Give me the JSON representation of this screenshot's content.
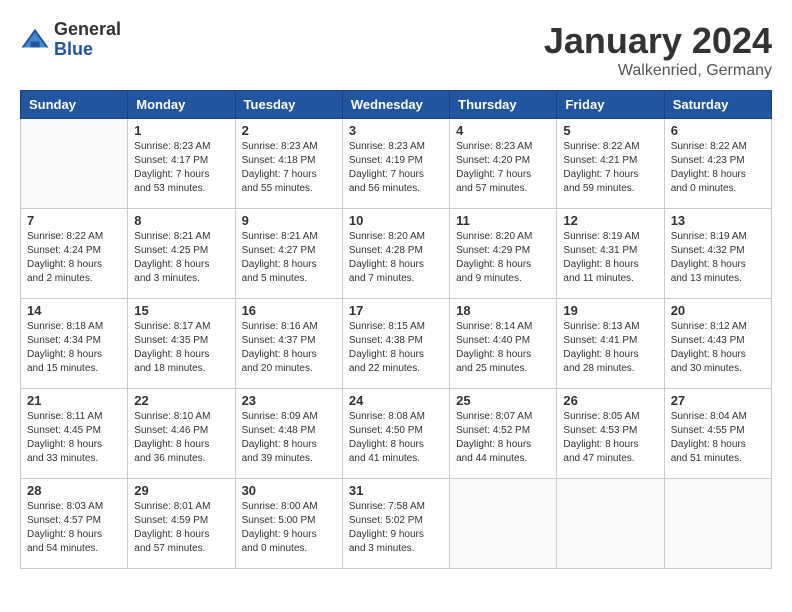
{
  "header": {
    "logo_general": "General",
    "logo_blue": "Blue",
    "month_title": "January 2024",
    "location": "Walkenried, Germany"
  },
  "weekdays": [
    "Sunday",
    "Monday",
    "Tuesday",
    "Wednesday",
    "Thursday",
    "Friday",
    "Saturday"
  ],
  "weeks": [
    [
      {
        "day": "",
        "sunrise": "",
        "sunset": "",
        "daylight": ""
      },
      {
        "day": "1",
        "sunrise": "Sunrise: 8:23 AM",
        "sunset": "Sunset: 4:17 PM",
        "daylight": "Daylight: 7 hours and 53 minutes."
      },
      {
        "day": "2",
        "sunrise": "Sunrise: 8:23 AM",
        "sunset": "Sunset: 4:18 PM",
        "daylight": "Daylight: 7 hours and 55 minutes."
      },
      {
        "day": "3",
        "sunrise": "Sunrise: 8:23 AM",
        "sunset": "Sunset: 4:19 PM",
        "daylight": "Daylight: 7 hours and 56 minutes."
      },
      {
        "day": "4",
        "sunrise": "Sunrise: 8:23 AM",
        "sunset": "Sunset: 4:20 PM",
        "daylight": "Daylight: 7 hours and 57 minutes."
      },
      {
        "day": "5",
        "sunrise": "Sunrise: 8:22 AM",
        "sunset": "Sunset: 4:21 PM",
        "daylight": "Daylight: 7 hours and 59 minutes."
      },
      {
        "day": "6",
        "sunrise": "Sunrise: 8:22 AM",
        "sunset": "Sunset: 4:23 PM",
        "daylight": "Daylight: 8 hours and 0 minutes."
      }
    ],
    [
      {
        "day": "7",
        "sunrise": "Sunrise: 8:22 AM",
        "sunset": "Sunset: 4:24 PM",
        "daylight": "Daylight: 8 hours and 2 minutes."
      },
      {
        "day": "8",
        "sunrise": "Sunrise: 8:21 AM",
        "sunset": "Sunset: 4:25 PM",
        "daylight": "Daylight: 8 hours and 3 minutes."
      },
      {
        "day": "9",
        "sunrise": "Sunrise: 8:21 AM",
        "sunset": "Sunset: 4:27 PM",
        "daylight": "Daylight: 8 hours and 5 minutes."
      },
      {
        "day": "10",
        "sunrise": "Sunrise: 8:20 AM",
        "sunset": "Sunset: 4:28 PM",
        "daylight": "Daylight: 8 hours and 7 minutes."
      },
      {
        "day": "11",
        "sunrise": "Sunrise: 8:20 AM",
        "sunset": "Sunset: 4:29 PM",
        "daylight": "Daylight: 8 hours and 9 minutes."
      },
      {
        "day": "12",
        "sunrise": "Sunrise: 8:19 AM",
        "sunset": "Sunset: 4:31 PM",
        "daylight": "Daylight: 8 hours and 11 minutes."
      },
      {
        "day": "13",
        "sunrise": "Sunrise: 8:19 AM",
        "sunset": "Sunset: 4:32 PM",
        "daylight": "Daylight: 8 hours and 13 minutes."
      }
    ],
    [
      {
        "day": "14",
        "sunrise": "Sunrise: 8:18 AM",
        "sunset": "Sunset: 4:34 PM",
        "daylight": "Daylight: 8 hours and 15 minutes."
      },
      {
        "day": "15",
        "sunrise": "Sunrise: 8:17 AM",
        "sunset": "Sunset: 4:35 PM",
        "daylight": "Daylight: 8 hours and 18 minutes."
      },
      {
        "day": "16",
        "sunrise": "Sunrise: 8:16 AM",
        "sunset": "Sunset: 4:37 PM",
        "daylight": "Daylight: 8 hours and 20 minutes."
      },
      {
        "day": "17",
        "sunrise": "Sunrise: 8:15 AM",
        "sunset": "Sunset: 4:38 PM",
        "daylight": "Daylight: 8 hours and 22 minutes."
      },
      {
        "day": "18",
        "sunrise": "Sunrise: 8:14 AM",
        "sunset": "Sunset: 4:40 PM",
        "daylight": "Daylight: 8 hours and 25 minutes."
      },
      {
        "day": "19",
        "sunrise": "Sunrise: 8:13 AM",
        "sunset": "Sunset: 4:41 PM",
        "daylight": "Daylight: 8 hours and 28 minutes."
      },
      {
        "day": "20",
        "sunrise": "Sunrise: 8:12 AM",
        "sunset": "Sunset: 4:43 PM",
        "daylight": "Daylight: 8 hours and 30 minutes."
      }
    ],
    [
      {
        "day": "21",
        "sunrise": "Sunrise: 8:11 AM",
        "sunset": "Sunset: 4:45 PM",
        "daylight": "Daylight: 8 hours and 33 minutes."
      },
      {
        "day": "22",
        "sunrise": "Sunrise: 8:10 AM",
        "sunset": "Sunset: 4:46 PM",
        "daylight": "Daylight: 8 hours and 36 minutes."
      },
      {
        "day": "23",
        "sunrise": "Sunrise: 8:09 AM",
        "sunset": "Sunset: 4:48 PM",
        "daylight": "Daylight: 8 hours and 39 minutes."
      },
      {
        "day": "24",
        "sunrise": "Sunrise: 8:08 AM",
        "sunset": "Sunset: 4:50 PM",
        "daylight": "Daylight: 8 hours and 41 minutes."
      },
      {
        "day": "25",
        "sunrise": "Sunrise: 8:07 AM",
        "sunset": "Sunset: 4:52 PM",
        "daylight": "Daylight: 8 hours and 44 minutes."
      },
      {
        "day": "26",
        "sunrise": "Sunrise: 8:05 AM",
        "sunset": "Sunset: 4:53 PM",
        "daylight": "Daylight: 8 hours and 47 minutes."
      },
      {
        "day": "27",
        "sunrise": "Sunrise: 8:04 AM",
        "sunset": "Sunset: 4:55 PM",
        "daylight": "Daylight: 8 hours and 51 minutes."
      }
    ],
    [
      {
        "day": "28",
        "sunrise": "Sunrise: 8:03 AM",
        "sunset": "Sunset: 4:57 PM",
        "daylight": "Daylight: 8 hours and 54 minutes."
      },
      {
        "day": "29",
        "sunrise": "Sunrise: 8:01 AM",
        "sunset": "Sunset: 4:59 PM",
        "daylight": "Daylight: 8 hours and 57 minutes."
      },
      {
        "day": "30",
        "sunrise": "Sunrise: 8:00 AM",
        "sunset": "Sunset: 5:00 PM",
        "daylight": "Daylight: 9 hours and 0 minutes."
      },
      {
        "day": "31",
        "sunrise": "Sunrise: 7:58 AM",
        "sunset": "Sunset: 5:02 PM",
        "daylight": "Daylight: 9 hours and 3 minutes."
      },
      {
        "day": "",
        "sunrise": "",
        "sunset": "",
        "daylight": ""
      },
      {
        "day": "",
        "sunrise": "",
        "sunset": "",
        "daylight": ""
      },
      {
        "day": "",
        "sunrise": "",
        "sunset": "",
        "daylight": ""
      }
    ]
  ]
}
